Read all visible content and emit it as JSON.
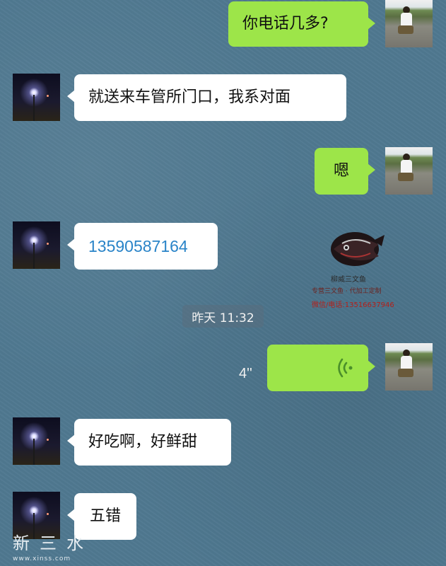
{
  "messages": [
    {
      "side": "right",
      "text": "你电话几多?"
    },
    {
      "side": "left",
      "text": "就送来车管所门口，我系对面"
    },
    {
      "side": "right",
      "text": "嗯"
    },
    {
      "side": "left",
      "text": "13590587164"
    },
    {
      "side": "right",
      "type": "voice",
      "duration": "4''"
    },
    {
      "side": "left",
      "text": "好吃啊，好鲜甜"
    },
    {
      "side": "left",
      "text": "五错"
    }
  ],
  "timestamp": "昨天 11:32",
  "watermark": {
    "title": "柳威三文鱼",
    "subtitle": "专营三文鱼  ·  代加工定制",
    "contact": "微信/电话:13516637946"
  },
  "site": {
    "name": "新三水",
    "url": "www.xinss.com"
  },
  "colors": {
    "background": "#4f7890",
    "outgoing_bubble": "#9de549",
    "incoming_bubble": "#ffffff",
    "link": "#2a84c8"
  }
}
